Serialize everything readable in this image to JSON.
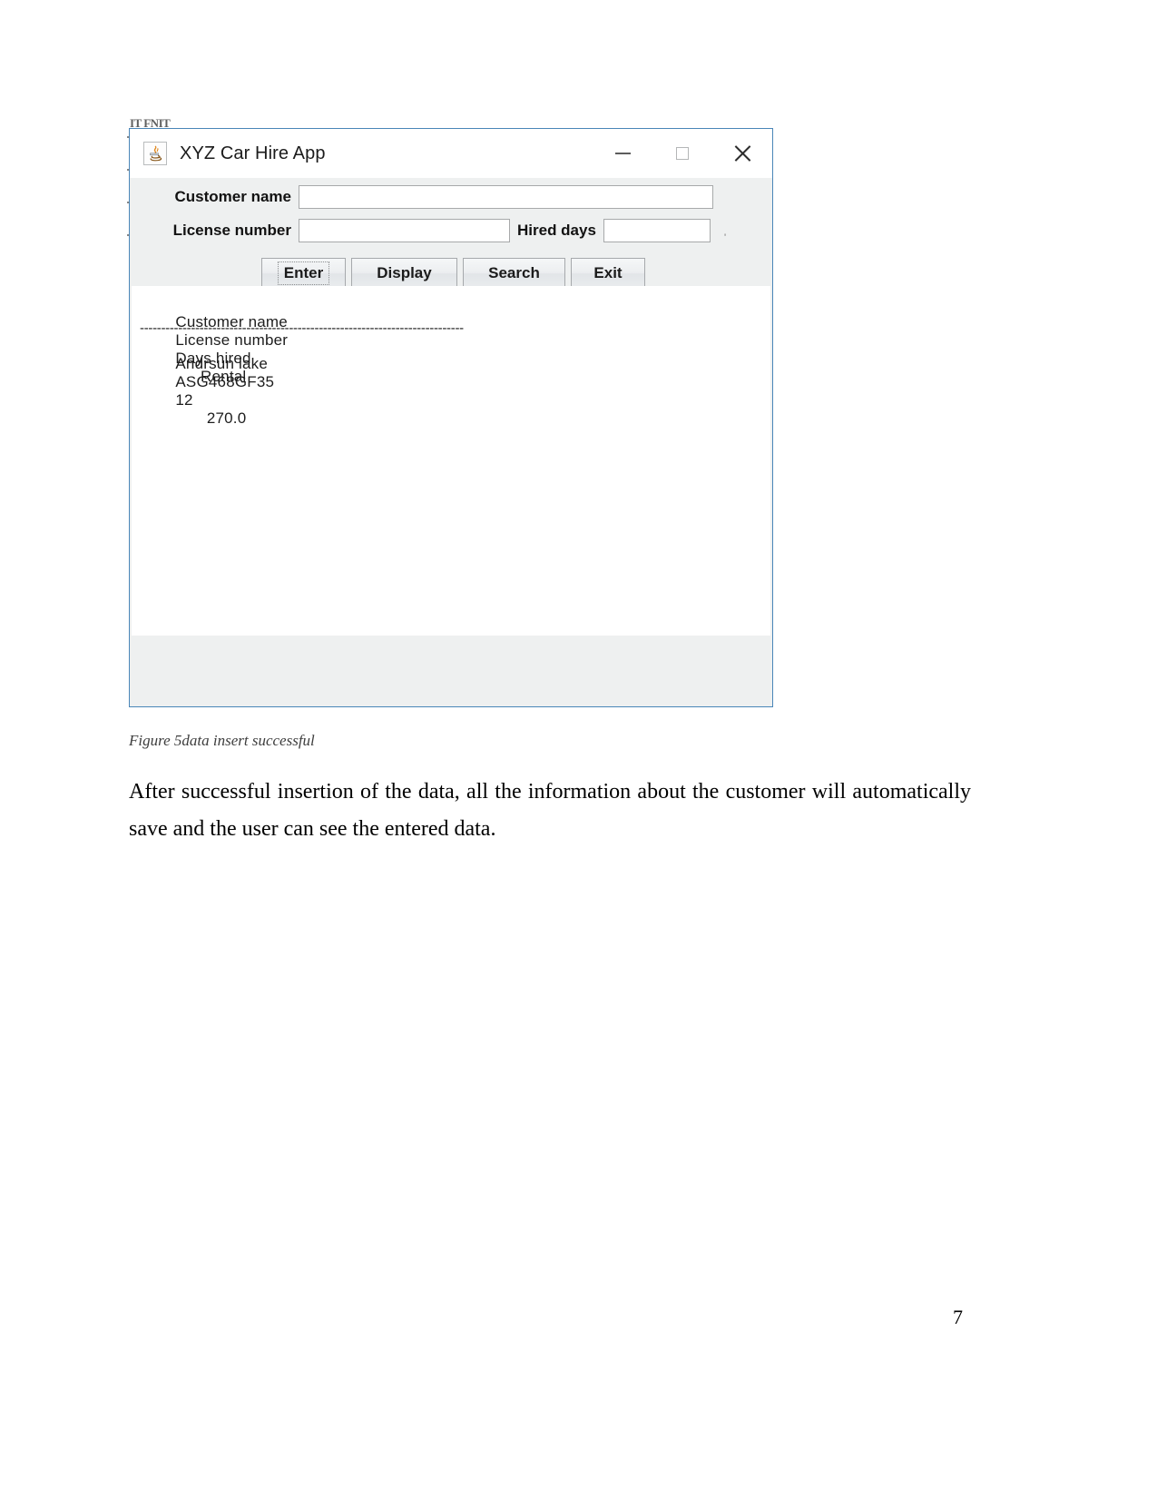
{
  "document": {
    "caption": "Figure 5data insert successful",
    "paragraph": "After successful insertion of the data, all the information about the customer will automatically save and the user can see the entered data.",
    "page_number": "7",
    "bleed_text": "IT FNIT"
  },
  "app_window": {
    "title": "XYZ Car Hire App",
    "icon": "java-coffee-cup-icon",
    "window_controls": {
      "minimize": "minimize-icon",
      "maximize": "maximize-icon",
      "close": "close-icon"
    },
    "form": {
      "customer_name": {
        "label": "Customer name",
        "value": "",
        "placeholder": ""
      },
      "license_number": {
        "label": "License number",
        "value": "",
        "placeholder": ""
      },
      "hired_days": {
        "label": "Hired days",
        "value": "",
        "placeholder": ""
      }
    },
    "buttons": [
      {
        "label": "Enter",
        "focused": true
      },
      {
        "label": "Display",
        "focused": false
      },
      {
        "label": "Search",
        "focused": false
      },
      {
        "label": "Exit",
        "focused": false
      }
    ],
    "results": {
      "columns": [
        "Customer name",
        "License number",
        "Days hired",
        "Rental"
      ],
      "separator": "----------------------------------------------------------------------------",
      "rows": [
        {
          "customer_name": "Andrsun lake",
          "license_number": "ASG468GF35",
          "days_hired": "12",
          "rental": "270.0"
        }
      ]
    }
  },
  "colors": {
    "window_border": "#4a86b8",
    "panel_bg": "#eef0f0",
    "list_bg": "#ffffff",
    "text": "#1b1b1b"
  }
}
